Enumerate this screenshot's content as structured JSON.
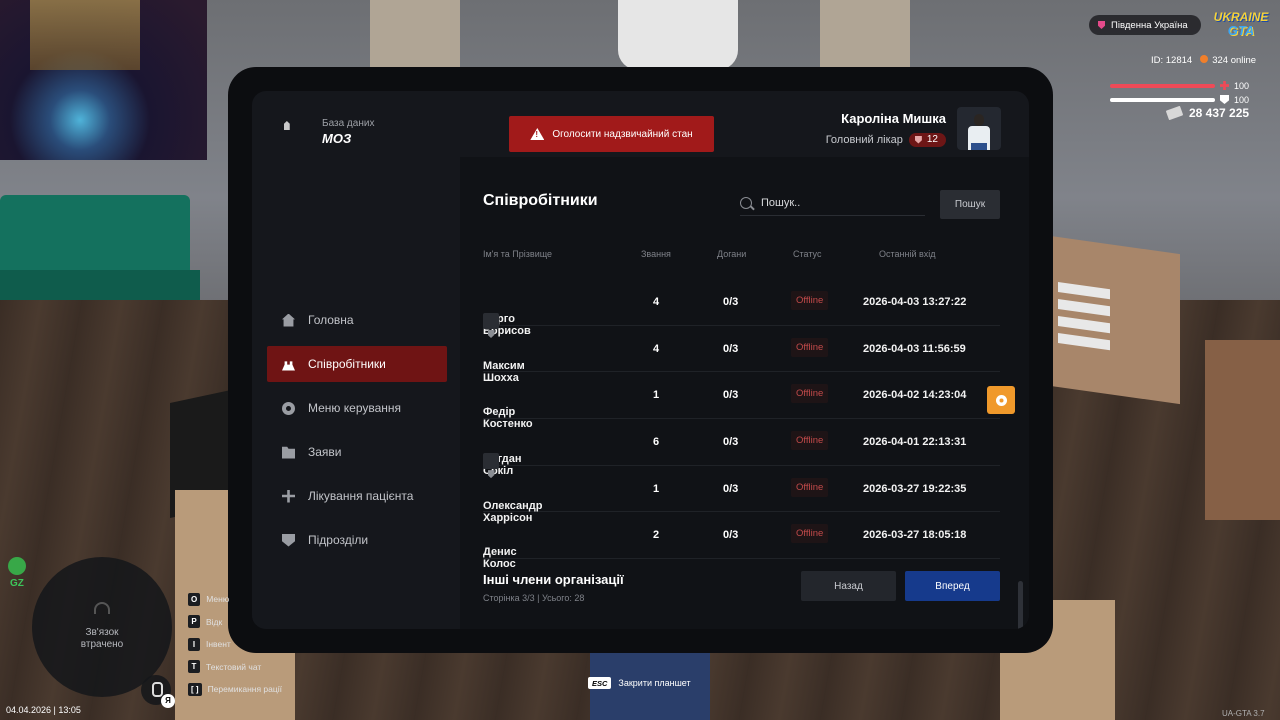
{
  "header": {
    "database_label": "База даних",
    "org_name": "МОЗ",
    "emergency_button": "Оголосити надзвичайний стан",
    "user_name": "Кароліна Мишка",
    "user_role": "Головний лікар",
    "user_rank": "12"
  },
  "sidebar": {
    "items": [
      {
        "label": "Головна",
        "icon": "home-icon"
      },
      {
        "label": "Співробітники",
        "icon": "people-icon",
        "active": true
      },
      {
        "label": "Меню керування",
        "icon": "gear-icon"
      },
      {
        "label": "Заяви",
        "icon": "folder-icon"
      },
      {
        "label": "Лікування пацієнта",
        "icon": "healing-icon"
      },
      {
        "label": "Підрозділи",
        "icon": "shield-icon"
      }
    ]
  },
  "main": {
    "title": "Співробітники",
    "search_placeholder": "Пошук..",
    "search_button": "Пошук",
    "columns": [
      "Ім'я та Прізвище",
      "Звання",
      "Догани",
      "Статус",
      "Останній вхід"
    ],
    "rows": [
      {
        "name": "Серго Борисов",
        "badge": true,
        "rank": "4",
        "warnings": "0/3",
        "status": "Offline",
        "last_login": "2026-04-03 13:27:22"
      },
      {
        "name": "Максим Шохха",
        "badge": false,
        "rank": "4",
        "warnings": "0/3",
        "status": "Offline",
        "last_login": "2026-04-03 11:56:59"
      },
      {
        "name": "Федір Костенко",
        "badge": false,
        "rank": "1",
        "warnings": "0/3",
        "status": "Offline",
        "last_login": "2026-04-02 14:23:04"
      },
      {
        "name": "Богдан Сокіл",
        "badge": true,
        "rank": "6",
        "warnings": "0/3",
        "status": "Offline",
        "last_login": "2026-04-01 22:13:31"
      },
      {
        "name": "Олександр Харрісон",
        "badge": false,
        "rank": "1",
        "warnings": "0/3",
        "status": "Offline",
        "last_login": "2026-03-27 19:22:35"
      },
      {
        "name": "Денис Колос",
        "badge": false,
        "rank": "2",
        "warnings": "0/3",
        "status": "Offline",
        "last_login": "2026-03-27 18:05:18"
      }
    ],
    "footer_title": "Інші члени організації",
    "footer_info": "Сторінка 3/3 | Усього: 28",
    "back_button": "Назад",
    "next_button": "Вперед"
  },
  "hud": {
    "server_name": "Південна Україна",
    "game_logo_line1": "UKRAINE",
    "game_logo_line2": "GTA",
    "player_id": "ID: 12814",
    "online": "324 online",
    "health": "100",
    "armor": "100",
    "money": "28 437 225",
    "zone_label": "GZ",
    "minimap_message_line1": "Зв'язок",
    "minimap_message_line2": "втрачено",
    "voice_key": "Я",
    "datetime": "04.04.2026 | 13:05",
    "keybinds": [
      {
        "key": "O",
        "label": "Меню"
      },
      {
        "key": "P",
        "label": "Відк"
      },
      {
        "key": "I",
        "label": "Інвент"
      },
      {
        "key": "T",
        "label": "Текстовий чат"
      },
      {
        "key": "[ ]",
        "label": "Перемикання рації"
      }
    ],
    "esc_key": "ESC",
    "esc_label": "Закрити планшет",
    "version": "UA-GTA 3.7"
  },
  "colors": {
    "accent_red": "#6f1414",
    "emergency_red": "#a11a1a",
    "next_blue": "#163a8c",
    "offline_red": "#c24a4a",
    "gear_orange": "#f0992b"
  }
}
